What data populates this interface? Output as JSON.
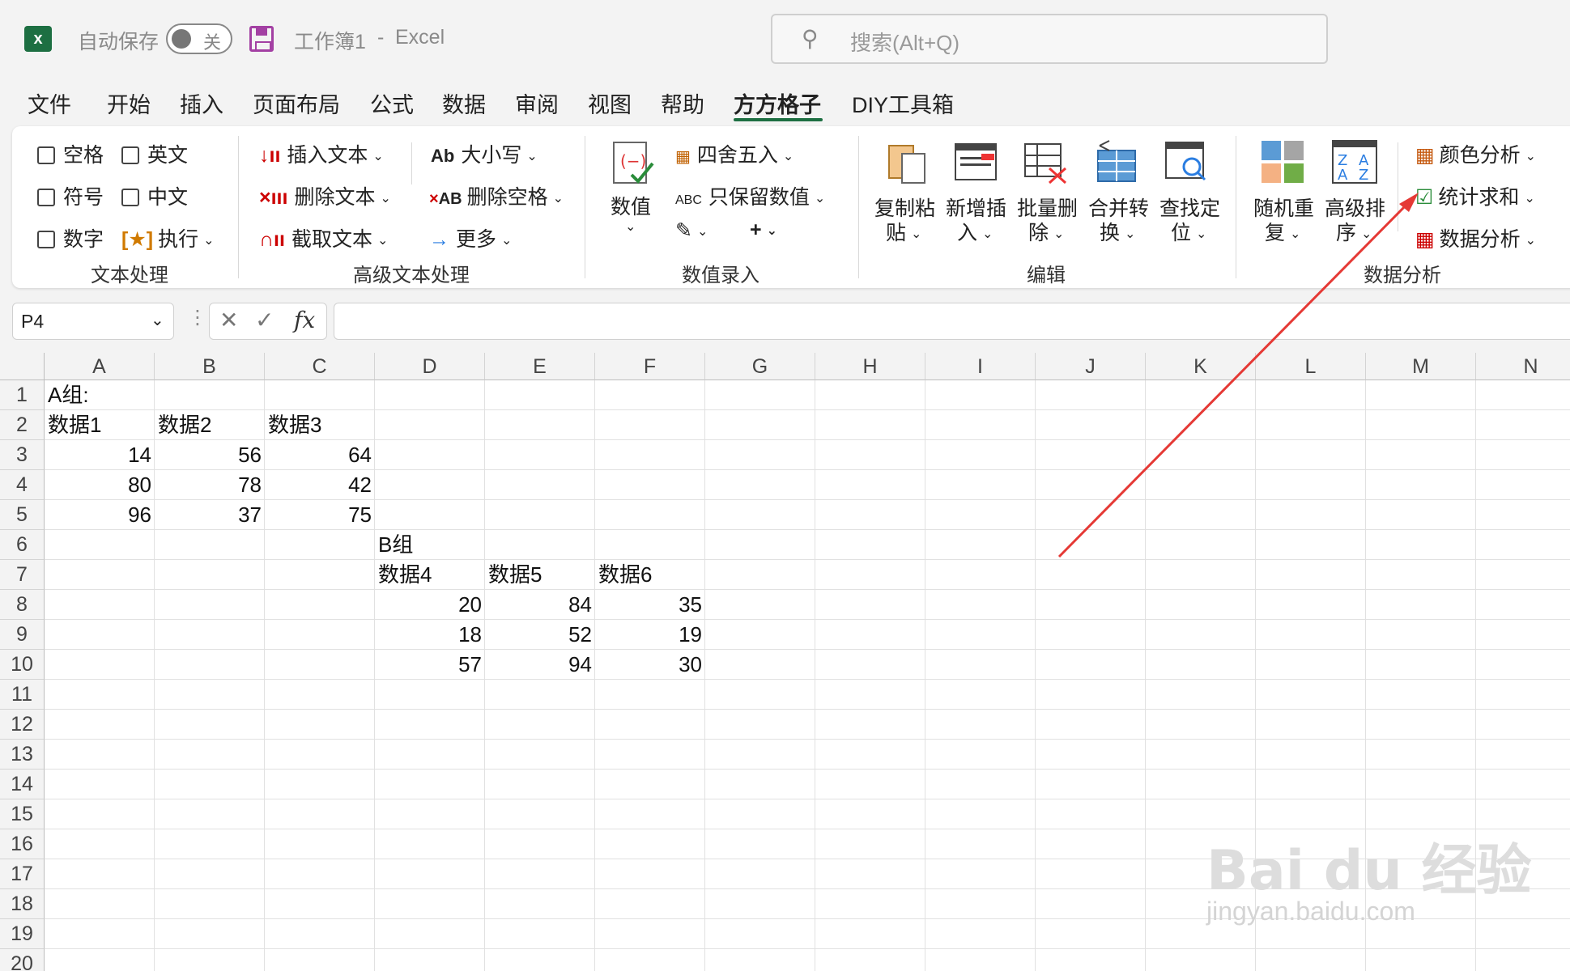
{
  "titlebar": {
    "app_icon": "excel-icon",
    "autosave_label": "自动保存",
    "autosave_state": "关",
    "doc_title": "工作簿1",
    "separator": "-",
    "app_name": "Excel",
    "search_placeholder": "搜索(Alt+Q)"
  },
  "tabs": [
    "文件",
    "开始",
    "插入",
    "页面布局",
    "公式",
    "数据",
    "审阅",
    "视图",
    "帮助",
    "方方格子",
    "DIY工具箱"
  ],
  "active_tab": "方方格子",
  "ribbon": {
    "text_processing": {
      "checkboxes": [
        "空格",
        "英文",
        "符号",
        "中文",
        "数字"
      ],
      "execute": "执行",
      "label": "文本处理"
    },
    "advanced_text": {
      "items": [
        "插入文本",
        "删除文本",
        "截取文本",
        "大小写",
        "删除空格",
        "更多"
      ],
      "label": "高级文本处理"
    },
    "numeric_entry": {
      "big_button": "数值",
      "items": [
        "四舍五入",
        "只保留数值"
      ],
      "label": "数值录入"
    },
    "edit": {
      "buttons": [
        {
          "line1": "复制粘",
          "line2": "贴"
        },
        {
          "line1": "新增插",
          "line2": "入"
        },
        {
          "line1": "批量删",
          "line2": "除"
        },
        {
          "line1": "合并转",
          "line2": "换"
        },
        {
          "line1": "查找定",
          "line2": "位"
        }
      ],
      "label": "编辑"
    },
    "data_analysis": {
      "buttons": [
        {
          "line1": "随机重",
          "line2": "复"
        },
        {
          "line1": "高级排",
          "line2": "序"
        }
      ],
      "items": [
        "颜色分析",
        "统计求和",
        "数据分析"
      ],
      "label": "数据分析"
    }
  },
  "formula_bar": {
    "name_box": "P4",
    "fx": "fx",
    "formula": ""
  },
  "columns": [
    "A",
    "B",
    "C",
    "D",
    "E",
    "F",
    "G",
    "H",
    "I",
    "J",
    "K",
    "L",
    "M",
    "N"
  ],
  "rows": [
    "1",
    "2",
    "3",
    "4",
    "5",
    "6",
    "7",
    "8",
    "9",
    "10",
    "11",
    "12",
    "13",
    "14",
    "15",
    "16",
    "17",
    "18",
    "19",
    "20"
  ],
  "cells": {
    "A1": "A组:",
    "A2": "数据1",
    "B2": "数据2",
    "C2": "数据3",
    "A3": "14",
    "B3": "56",
    "C3": "64",
    "A4": "80",
    "B4": "78",
    "C4": "42",
    "A5": "96",
    "B5": "37",
    "C5": "75",
    "D6": "B组",
    "D7": "数据4",
    "E7": "数据5",
    "F7": "数据6",
    "D8": "20",
    "E8": "84",
    "F8": "35",
    "D9": "18",
    "E9": "52",
    "F9": "19",
    "D10": "57",
    "E10": "94",
    "F10": "30"
  },
  "annotation": {
    "arrow_color": "#e53935",
    "points_to": "统计求和"
  },
  "watermark": {
    "logo": "Bai du 经验",
    "url": "jingyan.baidu.com"
  }
}
